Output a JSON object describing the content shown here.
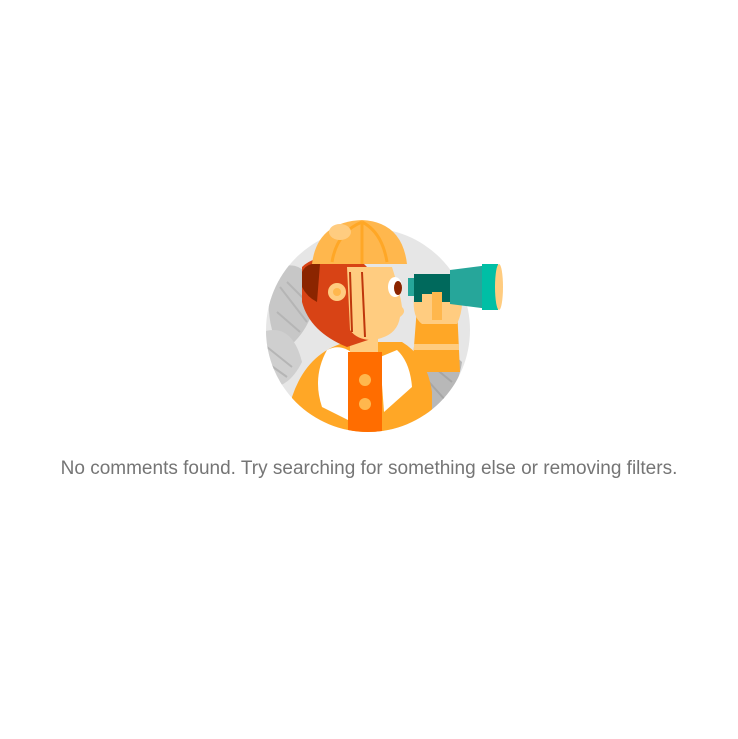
{
  "empty_state": {
    "illustration_icon": "person-with-binoculars-icon",
    "message": "No comments found. Try searching for something else or removing filters."
  },
  "colors": {
    "background": "#ffffff",
    "message_text": "#757575",
    "circle": "#e6e6e6",
    "leaves": "#c7c7c7",
    "hat": "#ffb74d",
    "hair": "#d84315",
    "skin": "#ffcc80",
    "shirt": "#ffa726",
    "vest": "#ff6d00",
    "binoculars_dark": "#00695c",
    "binoculars_light": "#26a69a"
  }
}
